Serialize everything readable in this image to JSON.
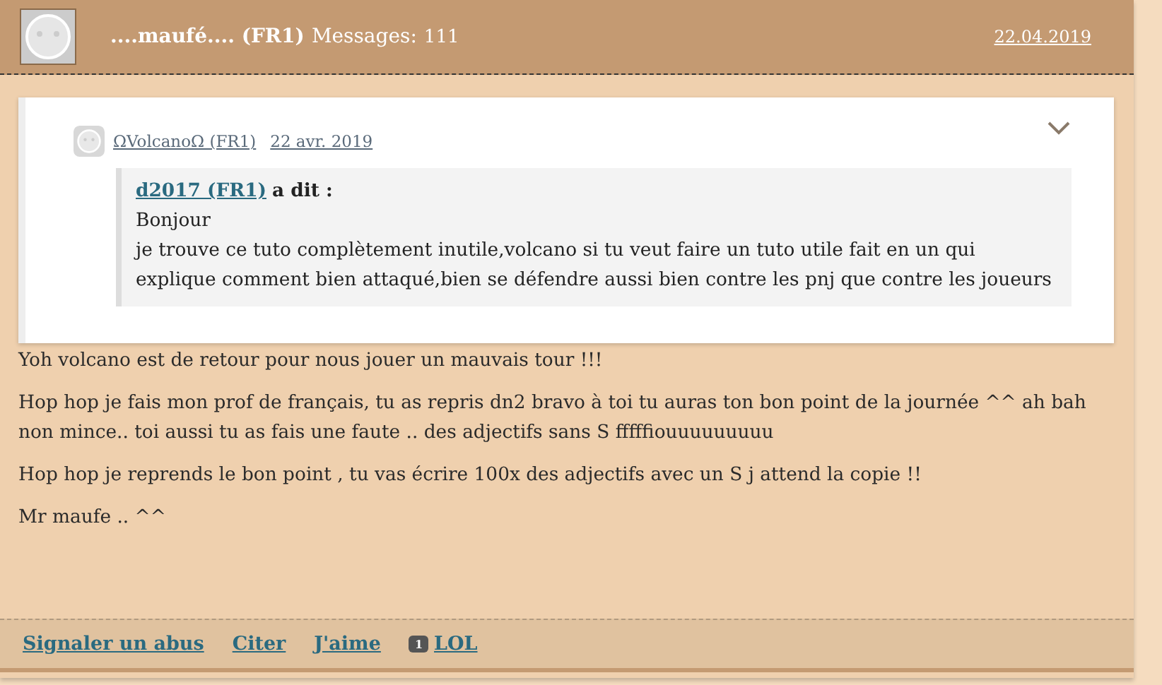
{
  "header": {
    "author": "....maufé.... (FR1)",
    "messages_label": "Messages:",
    "messages_count": "111",
    "date": "22.04.2019"
  },
  "quote_card": {
    "author": "ΩVolcanoΩ (FR1)",
    "date": "22 avr. 2019",
    "expanded": false,
    "inner_quote": {
      "author": "d2017 (FR1)",
      "said": "a dit :",
      "lines": [
        "Bonjour",
        "je trouve ce tuto complètement inutile,volcano si tu veut faire un tuto utile fait en un qui explique comment bien attaqué,bien se défendre aussi bien contre les pnj que contre les joueurs"
      ]
    }
  },
  "paragraphs": [
    "Yoh volcano est de retour pour nous jouer un mauvais tour !!!",
    "Hop hop je fais mon prof de français, tu as repris dn2 bravo à toi tu auras ton bon point de la journée ^^ ah bah non mince.. toi aussi tu as fais une faute .. des adjectifs sans S fffffiouuuuuuuuu",
    "Hop hop je reprends le bon point , tu vas écrire 100x des adjectifs avec un S j attend la copie !!",
    "Mr maufe .. ^^"
  ],
  "actions": [
    {
      "kind": "link",
      "label": "Signaler un abus"
    },
    {
      "kind": "link",
      "label": "Citer"
    },
    {
      "kind": "link",
      "label": "J'aime"
    },
    {
      "kind": "counted",
      "count": "1",
      "label": "LOL"
    }
  ]
}
